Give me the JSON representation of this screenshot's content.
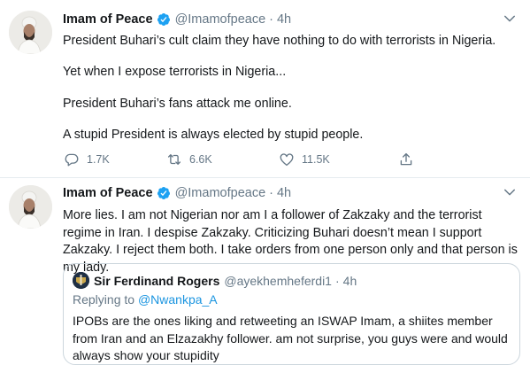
{
  "tweets": [
    {
      "author": {
        "name": "Imam of Peace",
        "handle": "@Imamofpeace",
        "verified": true
      },
      "time": "4h",
      "paragraphs": [
        "President Buhari’s cult claim they have nothing to do with terrorists in Nigeria.",
        "Yet when I expose terrorists in Nigeria...",
        "President Buhari’s fans attack me online.",
        "A stupid President is always elected by stupid people."
      ],
      "stats": {
        "replies": "1.7K",
        "retweets": "6.6K",
        "likes": "11.5K"
      }
    },
    {
      "author": {
        "name": "Imam of Peace",
        "handle": "@Imamofpeace",
        "verified": true
      },
      "time": "4h",
      "text": "More lies. I am not Nigerian nor am I a follower of Zakzaky and the terrorist regime in Iran. I despise Zakzaky. Criticizing Buhari doesn’t mean I support Zakzaky. I reject them both. I take orders from one person only and that person is my lady.",
      "quote": {
        "author": {
          "name": "Sir Ferdinand Rogers",
          "handle": "@ayekhemheferdi1"
        },
        "time": "4h",
        "replying_label": "Replying to",
        "replying_to": "@Nwankpa_A",
        "text": "IPOBs are the ones liking and retweeting an ISWAP Imam, a shiites member from Iran and an Elzazakhy follower. am not surprise, you guys were and would always show your stupidity"
      }
    }
  ],
  "separator": "·",
  "colors": {
    "verified": "#1da1f2",
    "secondary_text": "#657786",
    "link": "#1b95e0",
    "border": "#e6ecf0"
  },
  "icons": [
    "reply-icon",
    "retweet-icon",
    "like-icon",
    "share-icon",
    "chevron-down-icon",
    "verified-badge-icon"
  ]
}
